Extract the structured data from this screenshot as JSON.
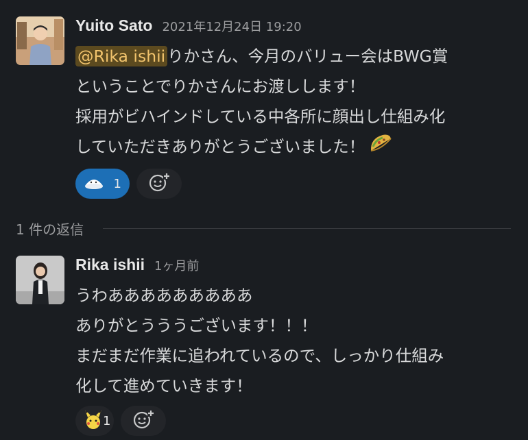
{
  "message1": {
    "author": "Yuito Sato",
    "timestamp": "2021年12月24日 19:20",
    "mention": "@Rika ishii",
    "lines": [
      "りかさん、今月のバリュー会はBWG賞",
      "ということでりかさんにお渡しします！",
      "採用がビハインドしている中各所に顔出し仕組み化",
      "していただきありがとうございました！"
    ],
    "inline_emoji": "taco-emoji",
    "reactions": [
      {
        "emoji": "rice-emoji",
        "count": "1",
        "active": true
      }
    ]
  },
  "thread_divider": {
    "label": "1 件の返信"
  },
  "message2": {
    "author": "Rika ishii",
    "timestamp": "1ヶ月前",
    "lines": [
      "うわあああああああああ",
      "ありがとうううございます！！！",
      "まだまだ作業に追われているので、しっかり仕組み",
      "化して進めていきます！"
    ],
    "reactions": [
      {
        "emoji": "pikachu-emoji",
        "count": "1",
        "active": false
      }
    ]
  },
  "colors": {
    "background": "#1a1d21",
    "mention_bg": "#5c4a1f",
    "mention_text": "#f2c46d",
    "reaction_active": "#1d6fb6",
    "reaction_plain": "#232529"
  },
  "icons": {
    "add_reaction": "add-reaction-icon"
  }
}
